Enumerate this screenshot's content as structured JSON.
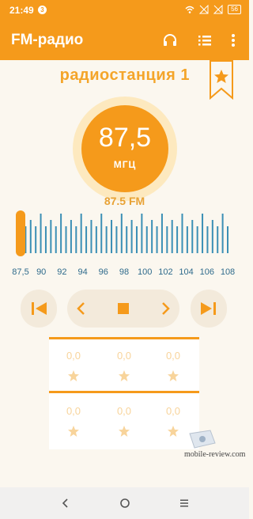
{
  "status_bar": {
    "time": "21:49",
    "notification_count": "3",
    "battery": "56"
  },
  "app_bar": {
    "title": "FM-радио",
    "icons": [
      "headphones-icon",
      "list-icon",
      "more-icon"
    ]
  },
  "station": {
    "name": "радиостанция 1",
    "favorite_icon": "bookmark-star-icon"
  },
  "dial": {
    "frequency": "87,5",
    "unit": "МГЦ"
  },
  "frequency_label": "87.5 FM",
  "tuner": {
    "current_value": 87.5,
    "range": [
      87.5,
      108
    ],
    "tick_labels": [
      "87,5",
      "90",
      "92",
      "94",
      "96",
      "98",
      "100",
      "102",
      "104",
      "106",
      "108"
    ]
  },
  "controls": [
    "prev-station-icon",
    "seek-back-icon",
    "stop-icon",
    "seek-forward-icon",
    "next-station-icon"
  ],
  "presets": [
    {
      "value": "0,0"
    },
    {
      "value": "0,0"
    },
    {
      "value": "0,0"
    },
    {
      "value": "0,0"
    },
    {
      "value": "0,0"
    },
    {
      "value": "0,0"
    }
  ],
  "watermark": "mobile-review.com",
  "colors": {
    "accent": "#f59a1b",
    "tick": "#3b8fb5",
    "background": "#fbf7ef"
  }
}
